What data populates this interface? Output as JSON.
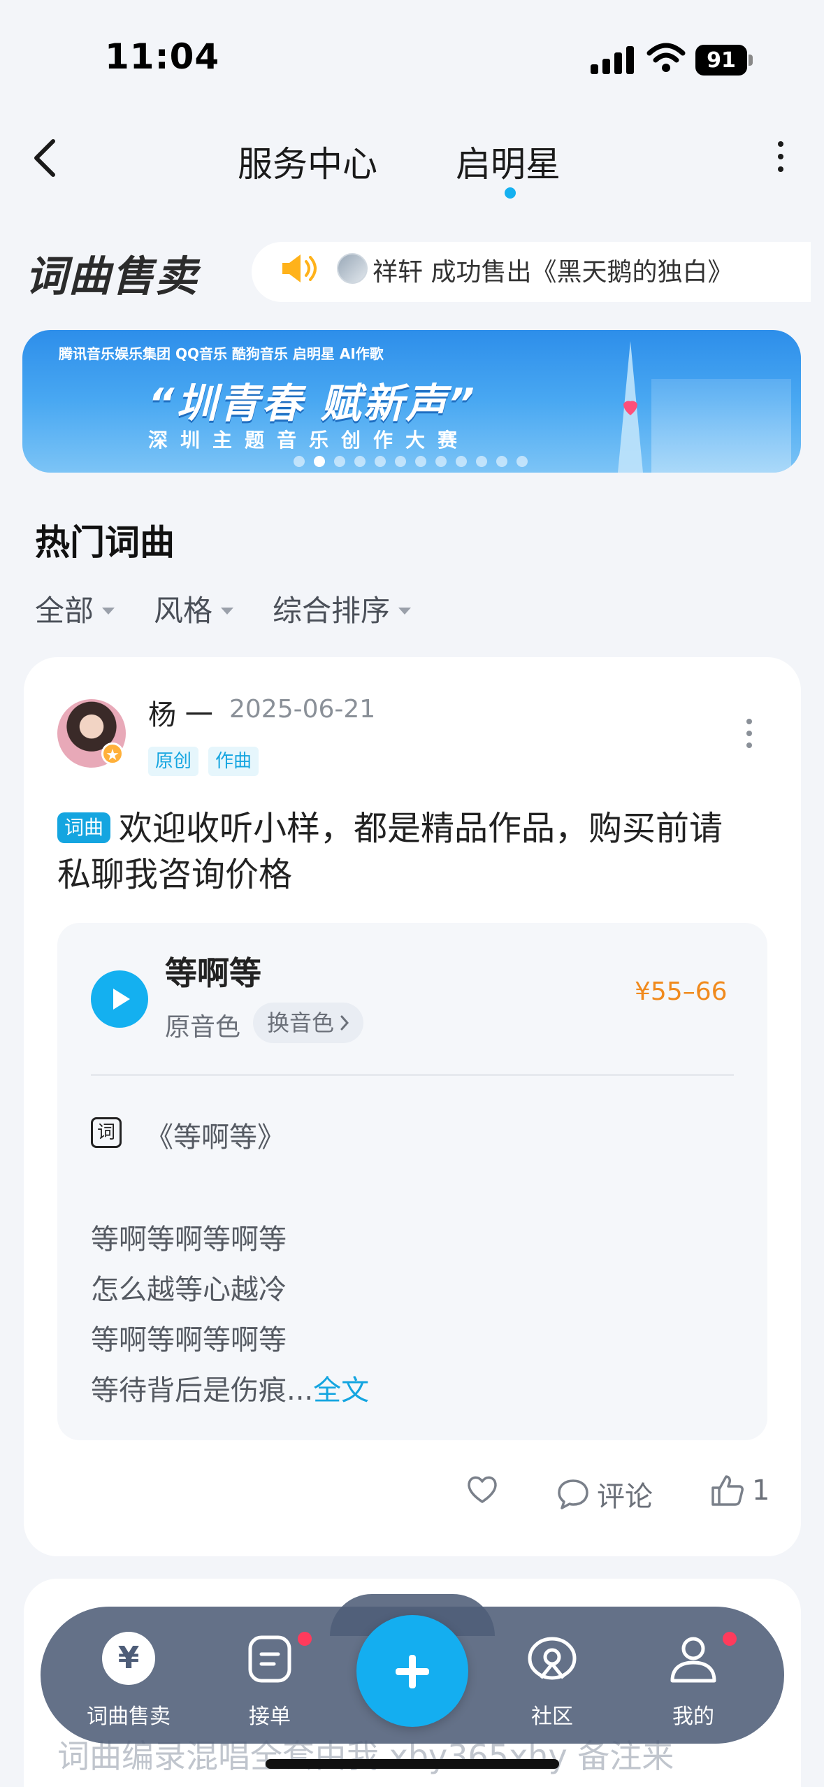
{
  "status_bar": {
    "time": "11:04",
    "battery": "91"
  },
  "nav": {
    "tabs": [
      "服务中心",
      "启明星"
    ],
    "active_tab": "启明星"
  },
  "section": {
    "brand": "词曲售卖",
    "ticker_user": "祥轩",
    "ticker_text": "成功售出《黑天鹅的独白》"
  },
  "banner": {
    "sponsors": "腾讯音乐娱乐集团  QQ音乐  酷狗音乐  启明星  AI作歌",
    "title": "“圳青春 赋新声”",
    "subtitle": "深圳主题音乐创作大赛",
    "dots_count": 12,
    "active_dot": 1
  },
  "hot": {
    "title": "热门词曲",
    "filters": [
      "全部",
      "风格",
      "综合排序"
    ]
  },
  "post": {
    "user": "杨 一",
    "date": "2025-06-21",
    "tags": [
      "原创",
      "作曲"
    ],
    "badge": "词曲",
    "text_line1": "欢迎收听小样，都是精品作品，购买前请",
    "text_line2": "私聊我咨询价格",
    "song": {
      "title": "等啊等",
      "voice": "原音色",
      "voice_switch": "换音色",
      "price": "¥55–66"
    },
    "lyric_icon": "词",
    "lyric_title": "《等啊等》",
    "lyrics": [
      "等啊等啊等啊等",
      "怎么越等心越冷",
      "等啊等啊等啊等",
      "等待背后是伤痕..."
    ],
    "full_text": "全文",
    "comment_label": "评论",
    "like_count": "1"
  },
  "next_post_preview": "词曲编录混唱全套由我 xby365xhy 备注来",
  "tabbar": {
    "items": [
      "词曲售卖",
      "接单",
      "社区",
      "我的"
    ],
    "active": "词曲售卖",
    "price_icon_glyph": "¥"
  },
  "colors": {
    "accent": "#14b0f0",
    "price": "#f08a1d",
    "badge_dot": "#ff3b5c"
  }
}
